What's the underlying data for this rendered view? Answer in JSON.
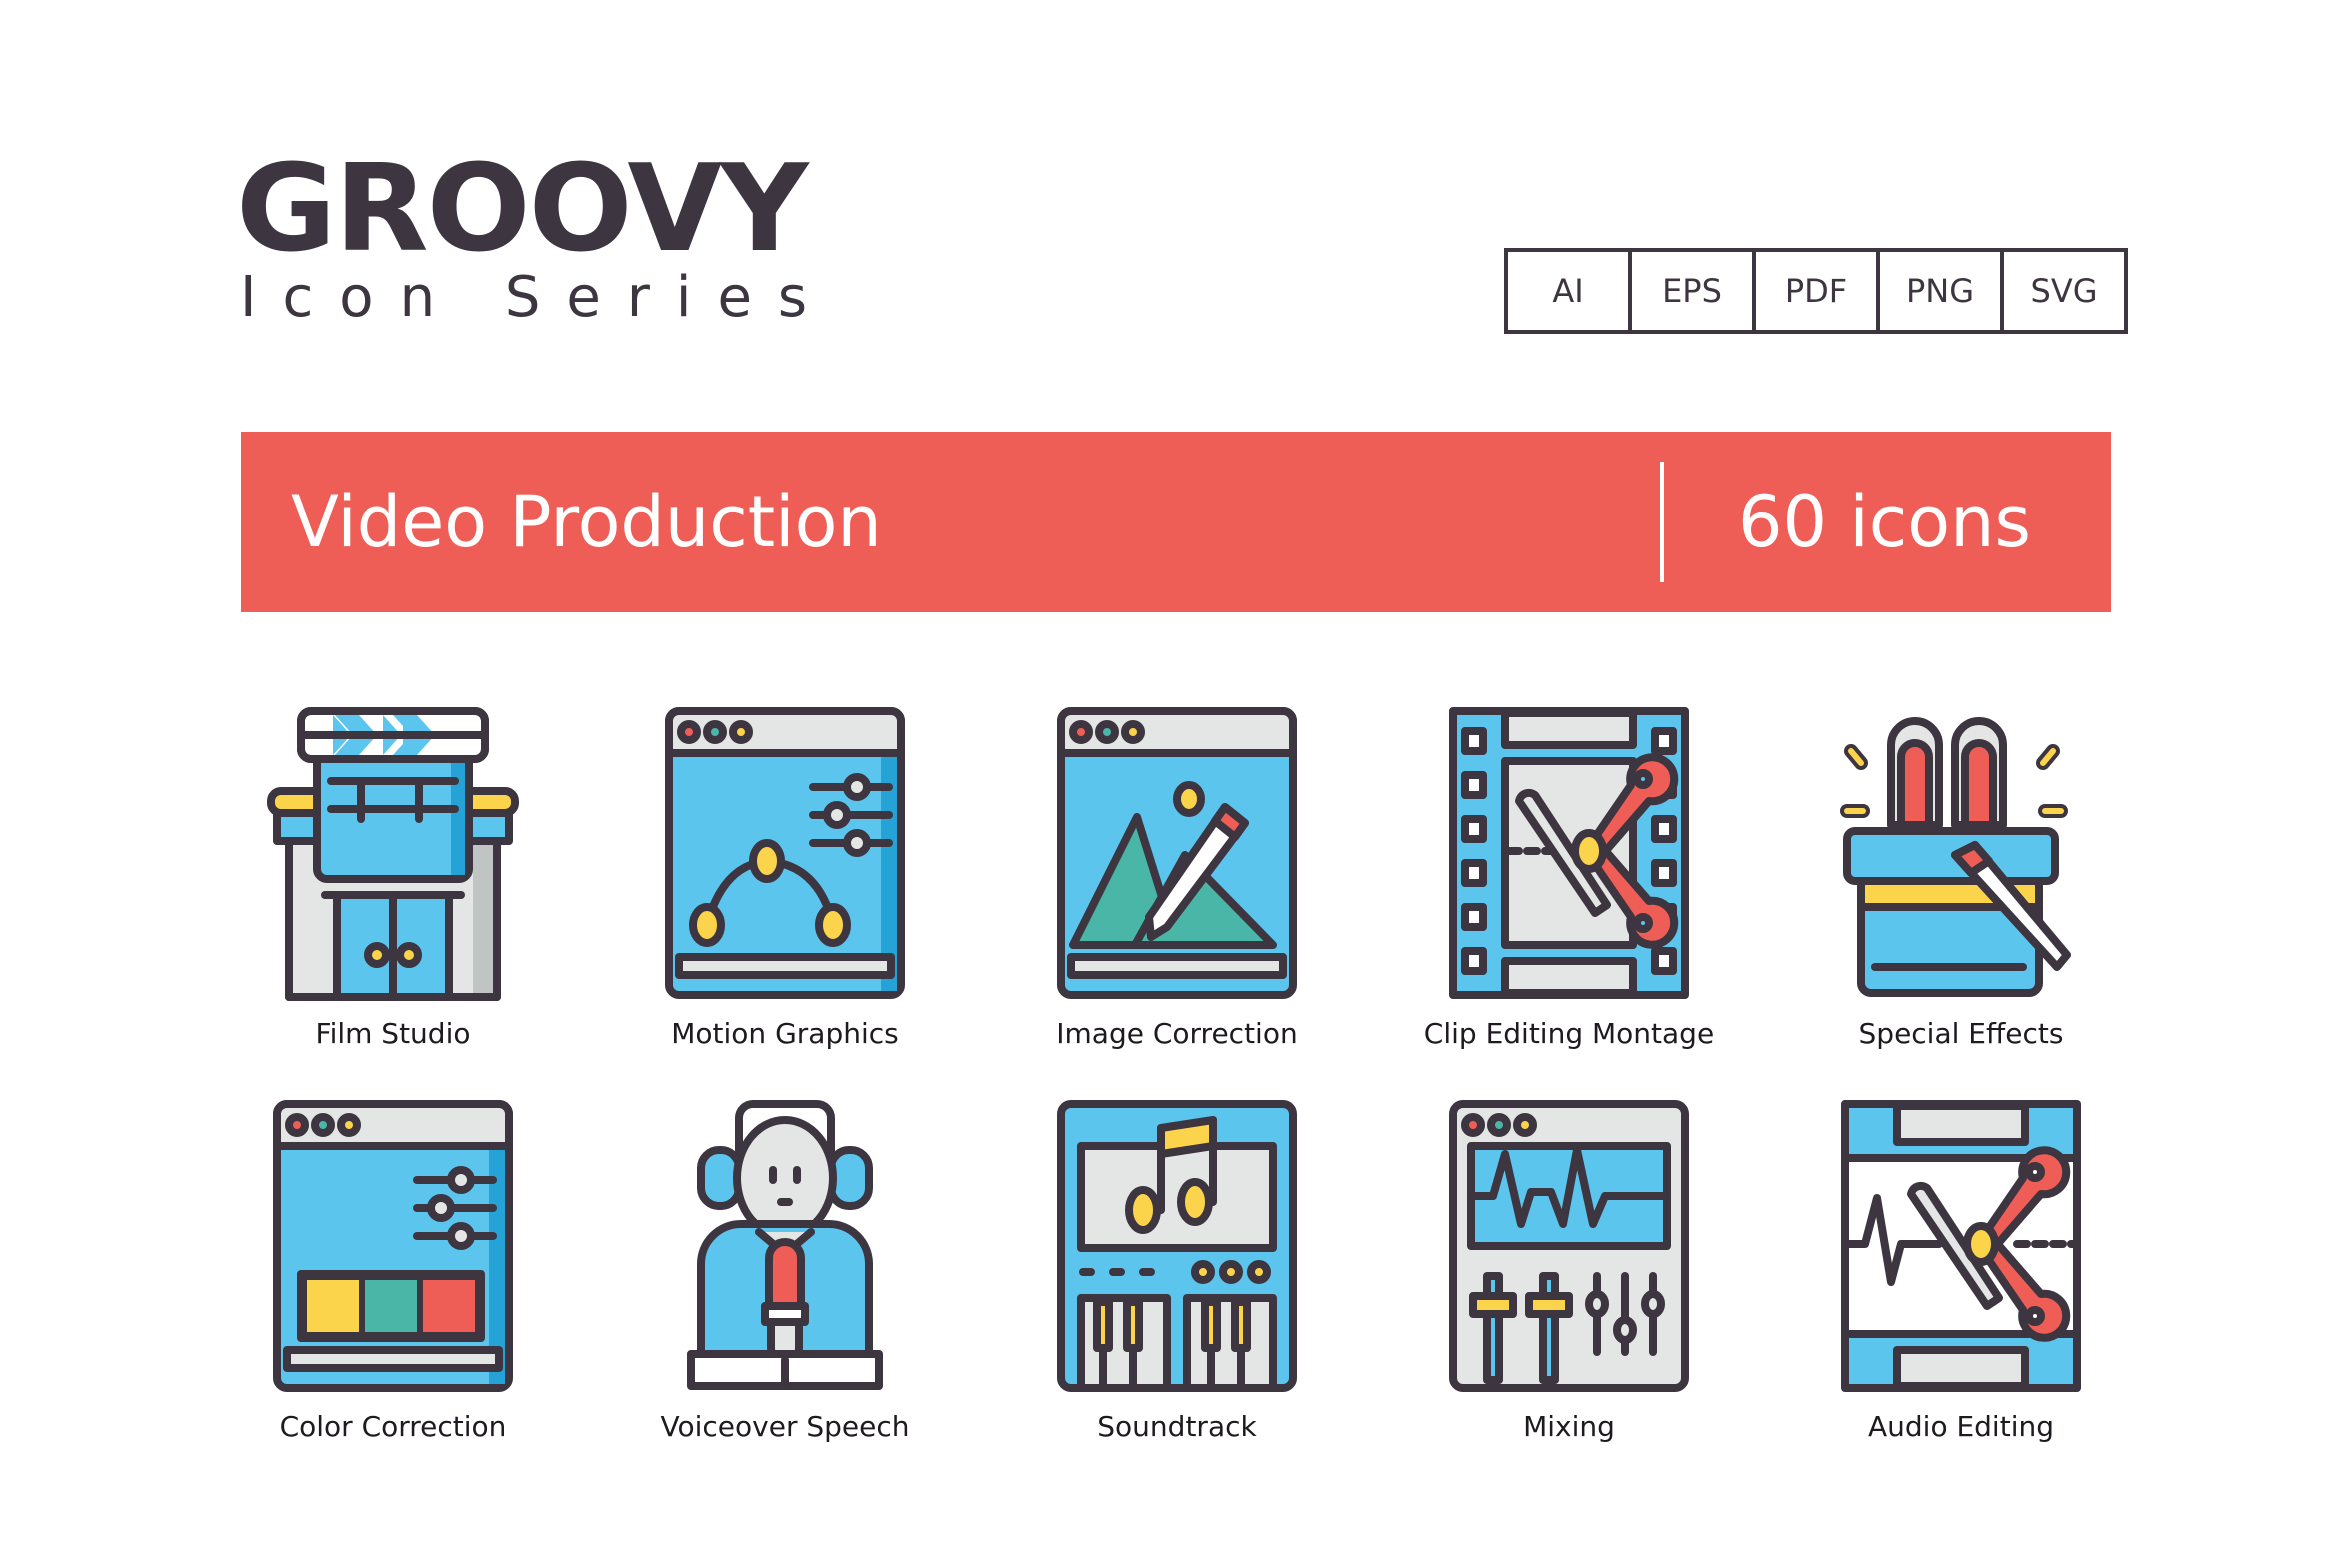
{
  "header": {
    "brand_title": "GROOVY",
    "brand_subtitle": "Icon Series",
    "formats": [
      "AI",
      "EPS",
      "PDF",
      "PNG",
      "SVG"
    ]
  },
  "banner": {
    "title": "Video Production",
    "count": "60 icons",
    "color": "#ee5e56"
  },
  "palette": {
    "outline": "#3d3540",
    "blue": "#5bc5ee",
    "blue_dark": "#25a2d6",
    "blue_light": "#9ddcf8",
    "red": "#ee5e56",
    "red_dark": "#d8433b",
    "yellow": "#fbd44c",
    "yellow_dark": "#f3ad2e",
    "teal": "#4ab6a8",
    "grey": "#e4e6e5",
    "grey_dark": "#c0c4c3",
    "white": "#ffffff"
  },
  "icons": [
    {
      "label": "Film Studio",
      "icon": "film-studio-icon"
    },
    {
      "label": "Motion Graphics",
      "icon": "motion-graphics-icon"
    },
    {
      "label": "Image Correction",
      "icon": "image-correction-icon"
    },
    {
      "label": "Clip Editing Montage",
      "icon": "clip-editing-montage-icon"
    },
    {
      "label": "Special Effects",
      "icon": "special-effects-icon"
    },
    {
      "label": "Color Correction",
      "icon": "color-correction-icon"
    },
    {
      "label": "Voiceover Speech",
      "icon": "voiceover-speech-icon"
    },
    {
      "label": "Soundtrack",
      "icon": "soundtrack-icon"
    },
    {
      "label": "Mixing",
      "icon": "mixing-icon"
    },
    {
      "label": "Audio Editing",
      "icon": "audio-editing-icon"
    }
  ]
}
